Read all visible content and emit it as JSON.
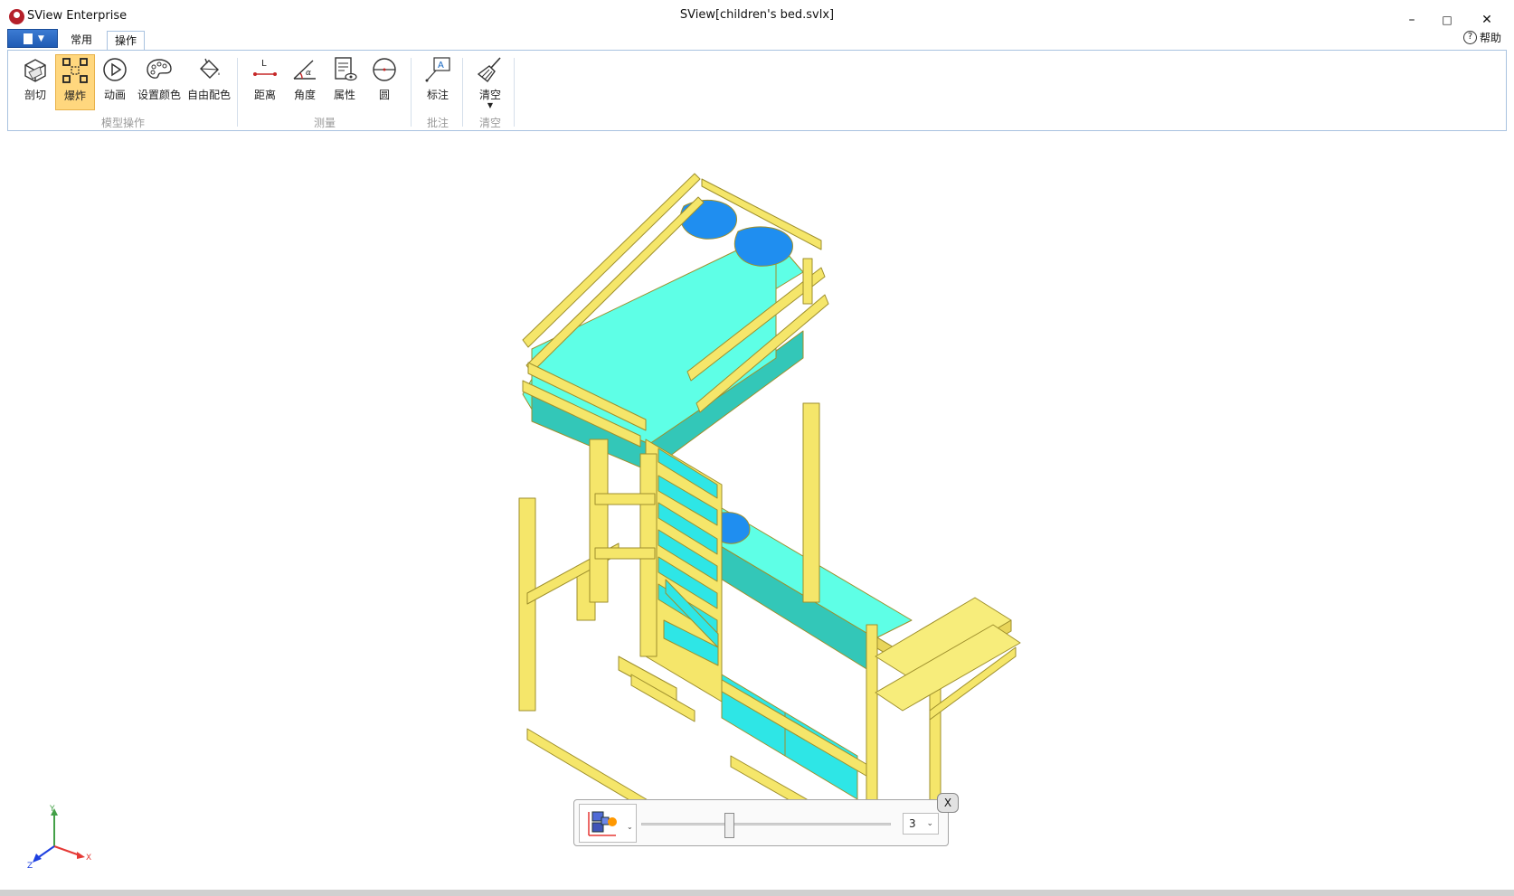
{
  "window": {
    "app_name": "SView Enterprise",
    "document_title": "SView[children's bed.svlx]",
    "minimize": "–",
    "maximize": "□",
    "close": "✕",
    "help_label": "帮助",
    "help_glyph": "?"
  },
  "tabs": [
    {
      "label": "常用"
    },
    {
      "label": "操作"
    }
  ],
  "ribbon": {
    "groups": [
      {
        "label": "模型操作",
        "tools": [
          {
            "label": "剖切",
            "icon": "section-cube-icon"
          },
          {
            "label": "爆炸",
            "icon": "explode-icon",
            "active": true
          },
          {
            "label": "动画",
            "icon": "play-icon"
          },
          {
            "label": "设置颜色",
            "icon": "palette-icon"
          },
          {
            "label": "自由配色",
            "icon": "paint-bucket-icon"
          }
        ]
      },
      {
        "label": "测量",
        "tools": [
          {
            "label": "距离",
            "icon": "distance-icon",
            "glyph": "L"
          },
          {
            "label": "角度",
            "icon": "angle-icon",
            "glyph": "α"
          },
          {
            "label": "属性",
            "icon": "properties-icon"
          },
          {
            "label": "圆",
            "icon": "circle-icon"
          }
        ]
      },
      {
        "label": "批注",
        "tools": [
          {
            "label": "标注",
            "icon": "annotation-icon",
            "glyph": "A"
          }
        ]
      },
      {
        "label": "清空",
        "tools": [
          {
            "label": "清空",
            "icon": "broom-icon"
          }
        ]
      }
    ]
  },
  "axis": {
    "x": "X",
    "y": "Y",
    "z": "Z"
  },
  "explode_panel": {
    "level": "3",
    "close_label": "X",
    "slider_value": 0.35
  },
  "colors": {
    "frame": "#f5e66a",
    "mattress": "#5effe6",
    "pillow": "#1f8ef0",
    "drawer": "#2ee6e6",
    "tab_active_border": "#a9c2e0",
    "tool_active": "#ffd77e"
  }
}
